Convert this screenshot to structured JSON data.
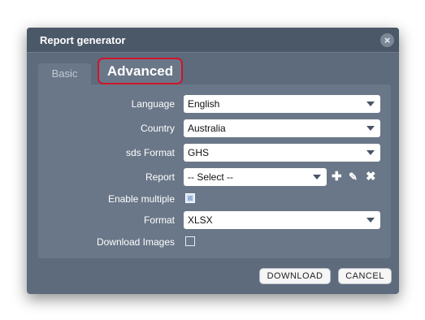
{
  "dialog": {
    "title": "Report generator",
    "close_icon": "close-icon"
  },
  "tabs": [
    {
      "label": "Basic",
      "active": false
    },
    {
      "label": "Advanced",
      "active": true
    }
  ],
  "form": {
    "language": {
      "label": "Language",
      "value": "English"
    },
    "country": {
      "label": "Country",
      "value": "Australia"
    },
    "sds_format": {
      "label": "sds Format",
      "value": "GHS"
    },
    "report": {
      "label": "Report",
      "value": "-- Select --",
      "actions": [
        "add-icon",
        "edit-icon",
        "delete-icon"
      ]
    },
    "enable_multiple": {
      "label": "Enable multiple",
      "checked": true
    },
    "format": {
      "label": "Format",
      "value": "XLSX"
    },
    "download_images": {
      "label": "Download Images",
      "checked": false
    }
  },
  "buttons": {
    "download": "DOWNLOAD",
    "cancel": "CANCEL"
  },
  "colors": {
    "titlebar": "#4b5868",
    "panel": "#6a7788",
    "highlight_border": "#d0152b"
  }
}
